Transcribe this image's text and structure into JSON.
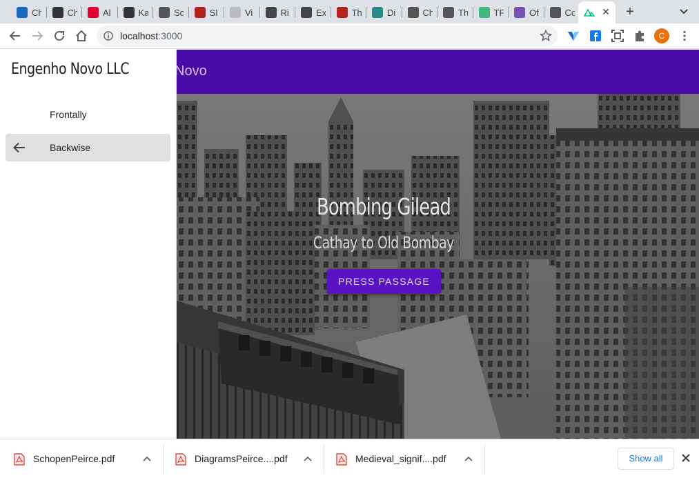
{
  "browser": {
    "tabs": [
      {
        "title": "Ch",
        "icon": "vuetify-icon",
        "color": "#1867c0"
      },
      {
        "title": "Ch",
        "icon": "ear-icon",
        "color": "#333333"
      },
      {
        "title": "Al",
        "icon": "angular-icon",
        "color": "#dd0031"
      },
      {
        "title": "Ka",
        "icon": "ear-icon",
        "color": "#333333"
      },
      {
        "title": "Sc",
        "icon": "wikipedia-icon",
        "color": "#555555"
      },
      {
        "title": "SI",
        "icon": "book-icon",
        "color": "#b22222"
      },
      {
        "title": "Vi",
        "icon": "link-icon",
        "color": "#bbbbbb"
      },
      {
        "title": "Ri",
        "icon": "globe-icon",
        "color": "#444444"
      },
      {
        "title": "Ex",
        "icon": "globe-icon",
        "color": "#444444"
      },
      {
        "title": "Th",
        "icon": "book-icon",
        "color": "#b22222"
      },
      {
        "title": "Di",
        "icon": "stack-icon",
        "color": "#2a8a8a"
      },
      {
        "title": "Ch",
        "icon": "wikipedia-icon",
        "color": "#555555"
      },
      {
        "title": "Th",
        "icon": "wikipedia-icon",
        "color": "#555555"
      },
      {
        "title": "TF",
        "icon": "vue-icon",
        "color": "#41b883"
      },
      {
        "title": "Of",
        "icon": "bootstrap-icon",
        "color": "#7952b3"
      },
      {
        "title": "Co",
        "icon": "codepen-icon",
        "color": "#555555"
      }
    ],
    "active_tab": {
      "title": "",
      "icon": "nuxt-icon",
      "color": "#00c58e"
    },
    "url_host": "localhost",
    "url_port": ":3000",
    "profile_initial": "C"
  },
  "drawer": {
    "title": "Engenho Novo LLC",
    "items": [
      {
        "label": "Frontally",
        "selected": false
      },
      {
        "label": "Backwise",
        "selected": true,
        "icon": "arrow-left-icon"
      }
    ]
  },
  "appbar": {
    "title": "Novo"
  },
  "hero": {
    "title": "Bombing Gilead",
    "subtitle": "Cathay to Old Bombay",
    "button_label": "PRESS PASSAGE"
  },
  "downloads": {
    "items": [
      {
        "name": "SchopenPeirce.pdf"
      },
      {
        "name": "DiagramsPeirce....pdf"
      },
      {
        "name": "Medieval_signif....pdf"
      }
    ],
    "show_all_label": "Show all"
  },
  "colors": {
    "appbar": "#4a0aa6",
    "button": "#5b12c4",
    "accent": "#1a73e8"
  }
}
